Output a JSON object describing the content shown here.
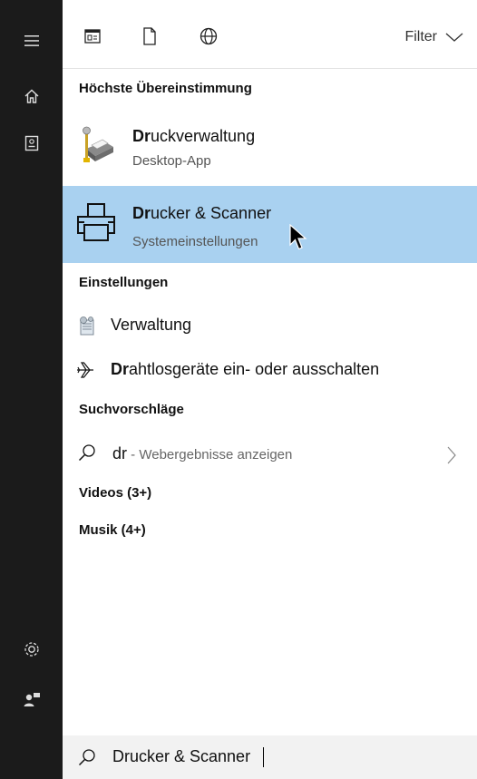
{
  "sidebar": {
    "icons": [
      "hamburger-menu-icon",
      "home-icon",
      "notebook-icon",
      "gear-icon",
      "user-feedback-icon"
    ]
  },
  "toolbar": {
    "icons": [
      "apps-icon",
      "document-icon",
      "web-globe-icon"
    ],
    "filter_label": "Filter"
  },
  "best_match": {
    "header": "Höchste Übereinstimmung",
    "items": [
      {
        "title_bold": "Dr",
        "title_rest": "uckverwaltung",
        "subtitle": "Desktop-App",
        "icon": "print-management-icon"
      },
      {
        "title_bold": "Dr",
        "title_rest": "ucker & Scanner",
        "subtitle": "Systemeinstellungen",
        "icon": "printer-icon",
        "selected": true
      }
    ]
  },
  "settings": {
    "header": "Einstellungen",
    "items": [
      {
        "bold": "",
        "label": "Verwaltung",
        "icon": "admin-tools-icon"
      },
      {
        "bold": "Dr",
        "label": "ahtlosgeräte ein- oder ausschalten",
        "icon": "airplane-icon"
      }
    ]
  },
  "suggestions": {
    "header": "Suchvorschläge",
    "query": "dr",
    "hint": " - Webergebnisse anzeigen"
  },
  "videos": {
    "header": "Videos (3+)"
  },
  "music": {
    "header": "Musik (4+)"
  },
  "search": {
    "value": "Drucker & Scanner"
  },
  "colors": {
    "rail": "#1b1b1b",
    "selected": "#a9d1f0",
    "searchbox": "#f2f2f2"
  }
}
